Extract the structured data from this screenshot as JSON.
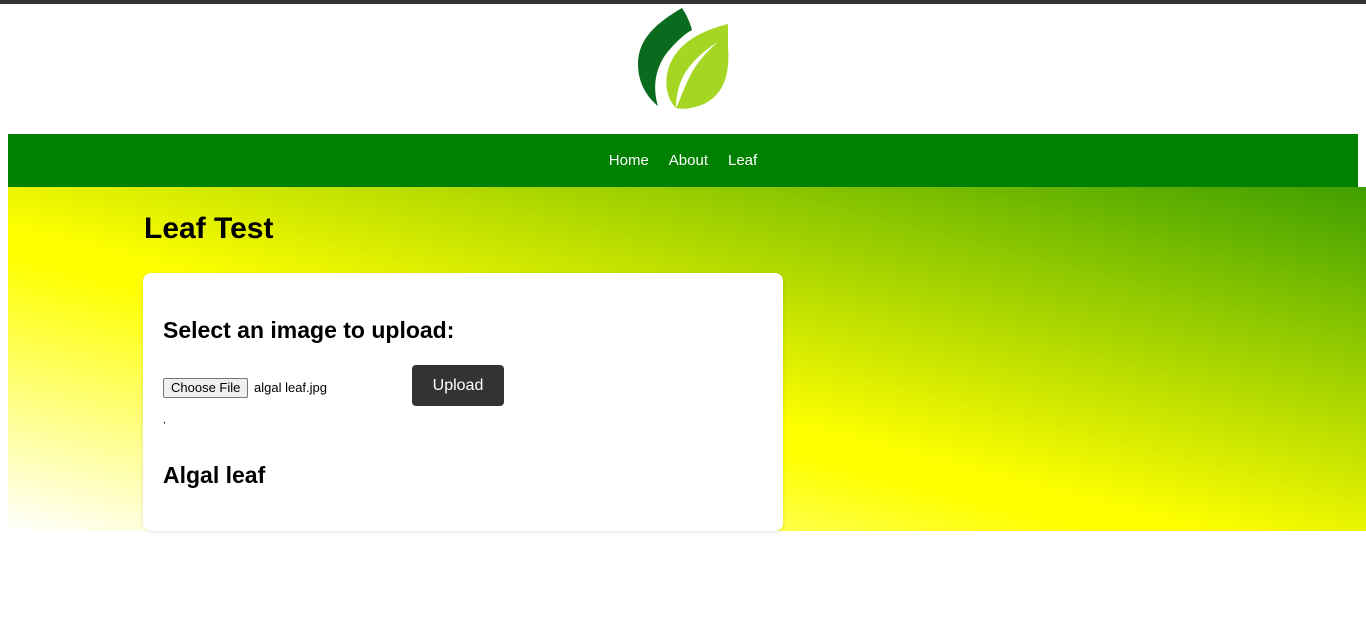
{
  "nav": {
    "items": [
      {
        "label": "Home"
      },
      {
        "label": "About"
      },
      {
        "label": "Leaf"
      }
    ]
  },
  "page": {
    "title": "Leaf Test"
  },
  "upload": {
    "heading": "Select an image to upload:",
    "choose_file_label": "Choose File",
    "file_name": "algal leaf.jpg",
    "upload_label": "Upload",
    "separator": ","
  },
  "result": {
    "label": "Algal leaf"
  },
  "colors": {
    "nav_bg": "#008000",
    "logo_dark": "#0a6b1e",
    "logo_light": "#a4d623",
    "button_bg": "#333333"
  }
}
